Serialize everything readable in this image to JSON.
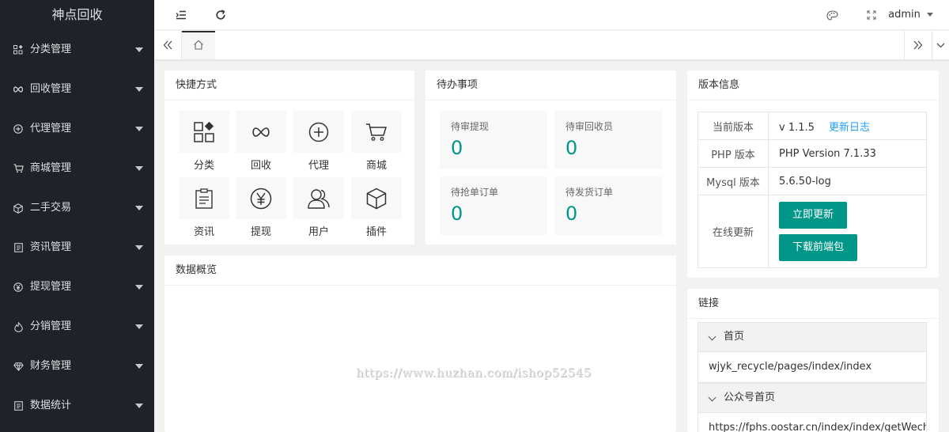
{
  "sidebar": {
    "logo": "神点回收",
    "items": [
      {
        "label": "分类管理",
        "icon": "category-icon",
        "glyph": "▦"
      },
      {
        "label": "回收管理",
        "icon": "infinity-icon",
        "glyph": "∞"
      },
      {
        "label": "代理管理",
        "icon": "plus-circle-icon",
        "glyph": "⊕"
      },
      {
        "label": "商城管理",
        "icon": "cart-icon",
        "glyph": "⛟"
      },
      {
        "label": "二手交易",
        "icon": "cube-icon",
        "glyph": "⬡"
      },
      {
        "label": "资讯管理",
        "icon": "document-icon",
        "glyph": "▤"
      },
      {
        "label": "提现管理",
        "icon": "yen-icon",
        "glyph": "¥"
      },
      {
        "label": "分销管理",
        "icon": "fire-icon",
        "glyph": "♨"
      },
      {
        "label": "财务管理",
        "icon": "diamond-icon",
        "glyph": "◈"
      },
      {
        "label": "数据统计",
        "icon": "chart-doc-icon",
        "glyph": "▤"
      }
    ]
  },
  "header": {
    "user": "admin",
    "icons": [
      "menu-fold-icon",
      "refresh-icon",
      "theme-palette-icon",
      "fullscreen-icon"
    ]
  },
  "tabs": {
    "home_icon": "home-icon"
  },
  "shortcuts": {
    "title": "快捷方式",
    "items": [
      {
        "label": "分类",
        "icon": "category-icon"
      },
      {
        "label": "回收",
        "icon": "infinity-icon"
      },
      {
        "label": "代理",
        "icon": "plus-circle-icon"
      },
      {
        "label": "商城",
        "icon": "cart-icon"
      },
      {
        "label": "资讯",
        "icon": "clipboard-icon"
      },
      {
        "label": "提现",
        "icon": "yen-circle-icon"
      },
      {
        "label": "用户",
        "icon": "user-icon"
      },
      {
        "label": "插件",
        "icon": "cube-icon"
      }
    ]
  },
  "todo": {
    "title": "待办事项",
    "items": [
      {
        "label": "待审提现",
        "value": "0"
      },
      {
        "label": "待审回收员",
        "value": "0"
      },
      {
        "label": "待抢单订单",
        "value": "0"
      },
      {
        "label": "待发货订单",
        "value": "0"
      }
    ]
  },
  "overview": {
    "title": "数据概览"
  },
  "version": {
    "title": "版本信息",
    "current_label": "当前版本",
    "current_value": "v 1.1.5",
    "changelog": "更新日志",
    "php_label": "PHP 版本",
    "php_value": "PHP Version 7.1.33",
    "mysql_label": "Mysql 版本",
    "mysql_value": "5.6.50-log",
    "update_label": "在线更新",
    "update_button": "立即更新",
    "download_button": "下载前端包"
  },
  "links": {
    "title": "链接",
    "groups": [
      {
        "label": "首页",
        "value": "wjyk_recycle/pages/index/index"
      },
      {
        "label": "公众号首页",
        "value": "https://fphs.oostar.cn/index/index/getWechat"
      }
    ]
  },
  "watermark": "https://www.huzhan.com/ishop52545",
  "colors": {
    "sidebar_bg": "#20222a",
    "accent": "#009688",
    "link": "#1e9fff"
  }
}
